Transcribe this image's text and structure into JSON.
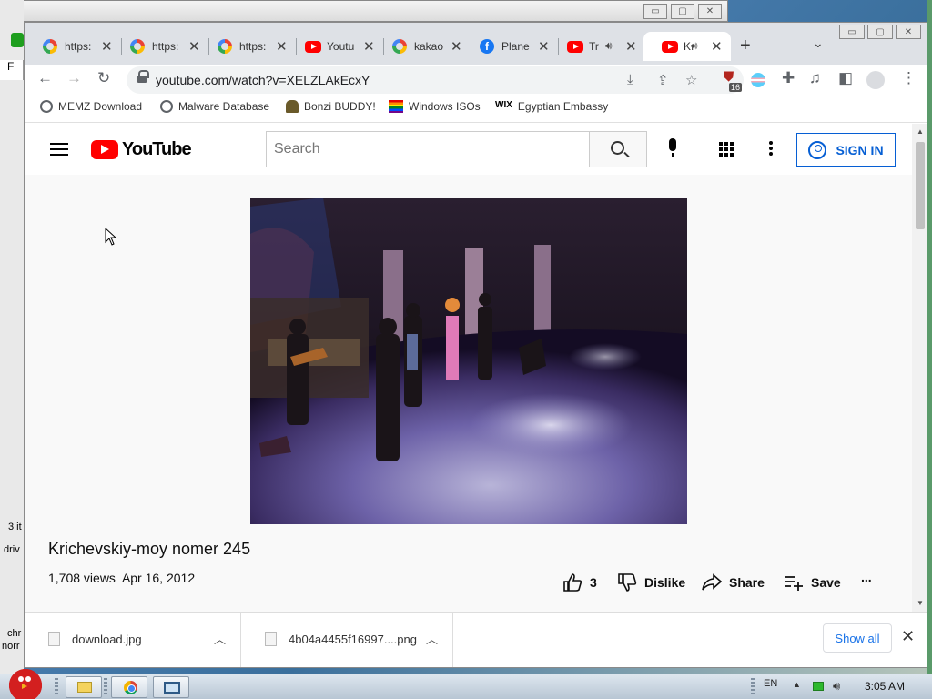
{
  "desktop": {
    "left_fragments": [
      "F",
      "3 it",
      "driv",
      "chr",
      "norr"
    ],
    "bg_window_buttons": [
      "▭",
      "▢",
      "✕"
    ]
  },
  "browser": {
    "tabs": [
      {
        "label": "https:",
        "favicon": "google-icon",
        "active": false
      },
      {
        "label": "https:",
        "favicon": "google-icon",
        "active": false
      },
      {
        "label": "https:",
        "favicon": "google-icon",
        "active": false
      },
      {
        "label": "Youtu",
        "favicon": "youtube-icon",
        "active": false
      },
      {
        "label": "kakao",
        "favicon": "google-icon",
        "active": false
      },
      {
        "label": "Plane",
        "favicon": "facebook-icon",
        "active": false
      },
      {
        "label": "Tr",
        "favicon": "youtube-icon",
        "active": false,
        "audio": true
      },
      {
        "label": "Kı",
        "favicon": "youtube-icon",
        "active": true,
        "audio": true
      }
    ],
    "new_tab": "+",
    "tab_search": "⌄",
    "window_buttons": [
      "▭",
      "▢",
      "✕"
    ],
    "url": "youtube.com/watch?v=XELZLAkEcxY",
    "extension_badge": "16",
    "bookmarks": [
      {
        "label": "MEMZ Download",
        "icon": "globe-icon"
      },
      {
        "label": "Malware Database",
        "icon": "globe-icon"
      },
      {
        "label": "Bonzi BUDDY!",
        "icon": "bonzi-icon"
      },
      {
        "label": "Windows ISOs",
        "icon": "rainbow-flag-icon"
      },
      {
        "label": "Egyptian Embassy",
        "icon": "wix-icon",
        "icon_text": "WIX"
      }
    ]
  },
  "youtube": {
    "logo_text": "YouTube",
    "search_placeholder": "Search",
    "sign_in": "SIGN IN",
    "video": {
      "title": "Krichevskiy-moy nomer 245",
      "views": "1,708 views",
      "date": "Apr 16, 2012",
      "likes": "3",
      "dislike": "Dislike",
      "share": "Share",
      "save": "Save",
      "more": "..."
    }
  },
  "downloads": {
    "items": [
      {
        "name": "download.jpg"
      },
      {
        "name": "4b04a4455f16997....png"
      }
    ],
    "show_all": "Show all",
    "close": "✕"
  },
  "taskbar": {
    "language": "EN",
    "time": "3:05 AM"
  },
  "colors": {
    "youtube_red": "#ff0000",
    "signin_blue": "#065fd4",
    "chrome_blue": "#1a73e8"
  }
}
